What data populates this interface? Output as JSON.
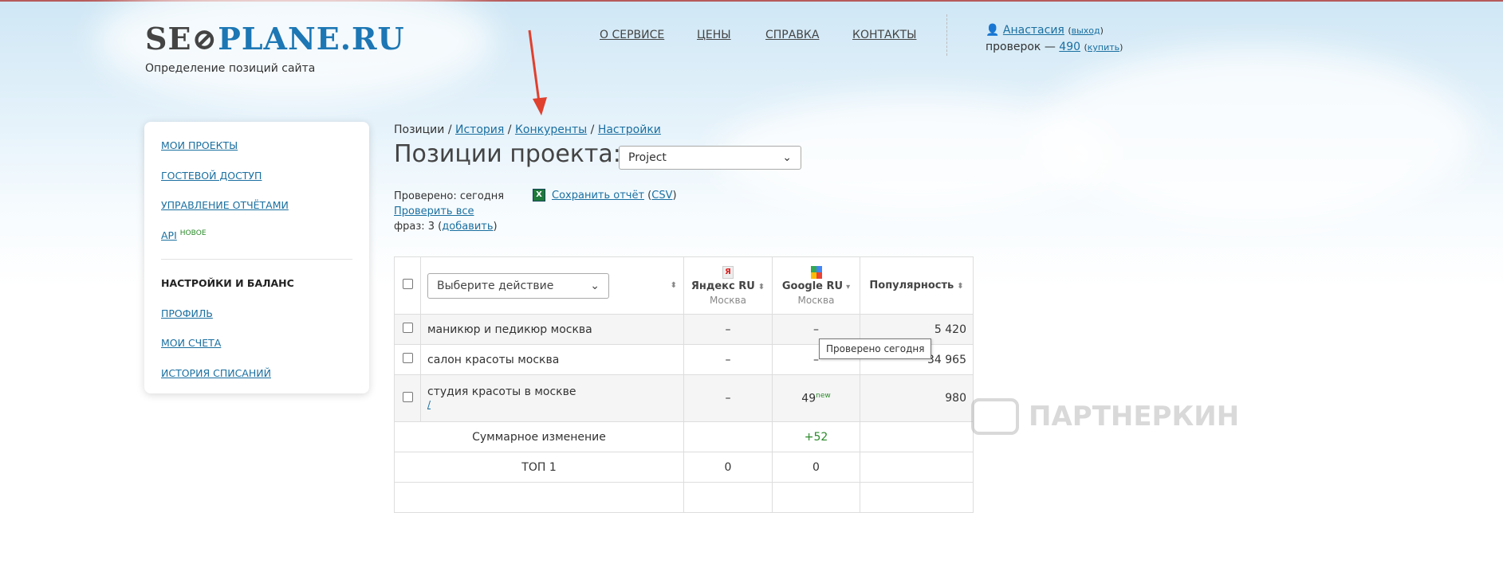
{
  "header": {
    "logo": "SEOPLANE.RU",
    "logo_part1": "SE",
    "logo_part2": "PLANE.RU",
    "tagline": "Определение позиций сайта",
    "nav": [
      "О СЕРВИСЕ",
      "ЦЕНЫ",
      "СПРАВКА",
      "КОНТАКТЫ"
    ],
    "user": {
      "name": "Анастасия",
      "logout": "выход",
      "checks_label": "проверок —",
      "checks": "490",
      "buy": "купить"
    }
  },
  "sidebar": {
    "items": [
      "МОИ ПРОЕКТЫ",
      "ГОСТЕВОЙ ДОСТУП",
      "УПРАВЛЕНИЕ ОТЧЁТАМИ",
      "API"
    ],
    "api_badge": "НОВОЕ",
    "section": "НАСТРОЙКИ И БАЛАНС",
    "items2": [
      "ПРОФИЛЬ",
      "МОИ СЧЕТА",
      "ИСТОРИЯ СПИСАНИЙ"
    ]
  },
  "breadcrumb": {
    "current": "Позиции",
    "links": [
      "История",
      "Конкуренты",
      "Настройки"
    ]
  },
  "page": {
    "title": "Позиции проекта:",
    "project": "Project",
    "checked": "Проверено: сегодня",
    "check_all": "Проверить все",
    "phrases_label": "фраз: 3",
    "add": "добавить",
    "save_report": "Сохранить отчёт",
    "csv": "CSV"
  },
  "table": {
    "action_placeholder": "Выберите действие",
    "columns": [
      {
        "name": "Яндекс RU",
        "region": "Москва"
      },
      {
        "name": "Google RU",
        "region": "Москва"
      },
      {
        "name": "Популярность"
      }
    ],
    "rows": [
      {
        "phrase": "маникюр и педикюр москва",
        "yandex": "–",
        "google": "–",
        "popularity": "5 420"
      },
      {
        "phrase": "салон красоты москва",
        "yandex": "–",
        "google": "–",
        "popularity": "34 965"
      },
      {
        "phrase": "студия красоты в москве",
        "url": "/",
        "yandex": "–",
        "google": "49",
        "google_badge": "new",
        "popularity": "980"
      }
    ],
    "summary": {
      "label": "Суммарное изменение",
      "google": "+52"
    },
    "top1": {
      "label": "ТОП 1",
      "yandex": "0",
      "google": "0"
    }
  },
  "tooltip": "Проверено сегодня",
  "watermark": "ПАРТНЕРКИН"
}
